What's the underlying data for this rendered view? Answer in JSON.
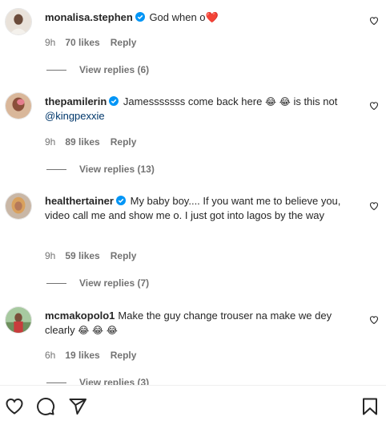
{
  "comments": [
    {
      "username": "monalisa.stephen",
      "text": "God when o",
      "heart": "❤️",
      "time": "9h",
      "likes": "70 likes",
      "reply": "Reply",
      "view_replies": "View replies (6)"
    },
    {
      "username": "thepamilerin",
      "text": "Jamesssssss come back here",
      "emoji": "😂 😂",
      "text2": "is this not",
      "mention": "@kingpexxie",
      "time": "9h",
      "likes": "89 likes",
      "reply": "Reply",
      "view_replies": "View replies (13)"
    },
    {
      "username": "healthertainer",
      "text": "My baby boy.... If you want me to believe you, video call me and show me o. I just got into lagos by the way",
      "time": "9h",
      "likes": "59 likes",
      "reply": "Reply",
      "view_replies": "View replies (7)"
    },
    {
      "username": "mcmakopolo1",
      "text": "Make the guy change trouser na make we dey clearly",
      "emoji": "😂 😂 😂",
      "time": "6h",
      "likes": "19 likes",
      "reply": "Reply",
      "view_replies": "View replies (3)"
    }
  ],
  "colors": {
    "text": "#262626",
    "secondary": "#737373",
    "verified": "#0095f6",
    "mention": "#00376b",
    "heart": "#ed1c24"
  },
  "icons": {
    "comment_like": "heart-outline-icon",
    "bottom_bar": [
      "heart-icon",
      "comment-icon",
      "share-icon",
      "bookmark-icon"
    ]
  }
}
